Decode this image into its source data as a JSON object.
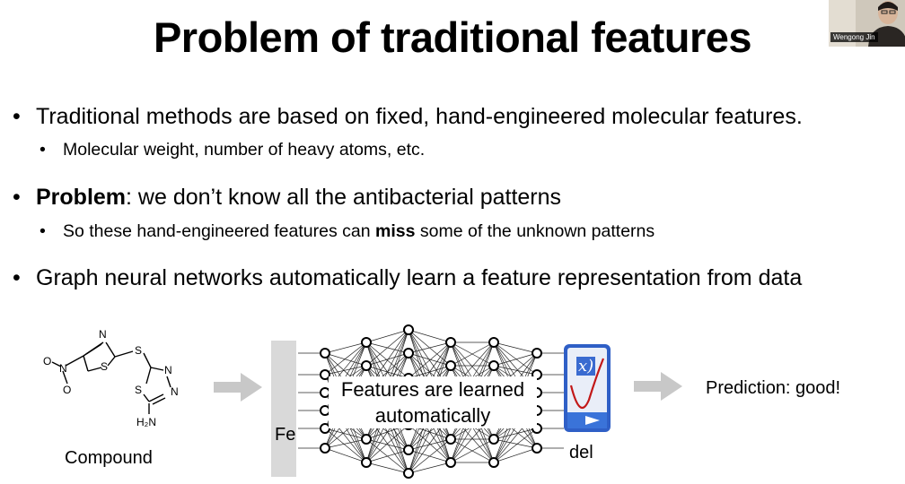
{
  "slide": {
    "title": "Problem of traditional features",
    "bullets": [
      {
        "prefix": "",
        "bold": "",
        "text": "Traditional methods are based on fixed, hand-engineered molecular features."
      },
      {
        "prefix": "",
        "bold": "Problem",
        "text": ": we don’t know all the antibacterial patterns"
      },
      {
        "prefix": "",
        "bold": "",
        "text": "Graph neural networks automatically learn a feature representation from data"
      }
    ],
    "subbullets": [
      {
        "pre": "Molecular weight, number of heavy atoms, etc.",
        "bold": "",
        "post": ""
      },
      {
        "pre": "So these hand-engineered features can ",
        "bold": "miss",
        "post": " some of the unknown patterns"
      }
    ],
    "bullet_glyph": "•"
  },
  "diagram": {
    "compound_label": "Compound",
    "overlay_line1": "Features are learned",
    "overlay_line2": "automatically",
    "fe_partial": "Fe",
    "model_partial": "del",
    "prediction": "Prediction: good!",
    "fx_partial": "x)",
    "atoms": {
      "n1": "N",
      "s1": "S",
      "s2": "S",
      "n2": "N",
      "n3": "N",
      "s3": "S",
      "nh2": "H₂N",
      "n4": "N",
      "o1": "O",
      "o2": "O"
    }
  },
  "webcam": {
    "name": "Wengong Jin"
  },
  "colors": {
    "arrow": "#c8c8c8",
    "panel": "#d9d9d9",
    "model_blue": "#3566c9"
  }
}
